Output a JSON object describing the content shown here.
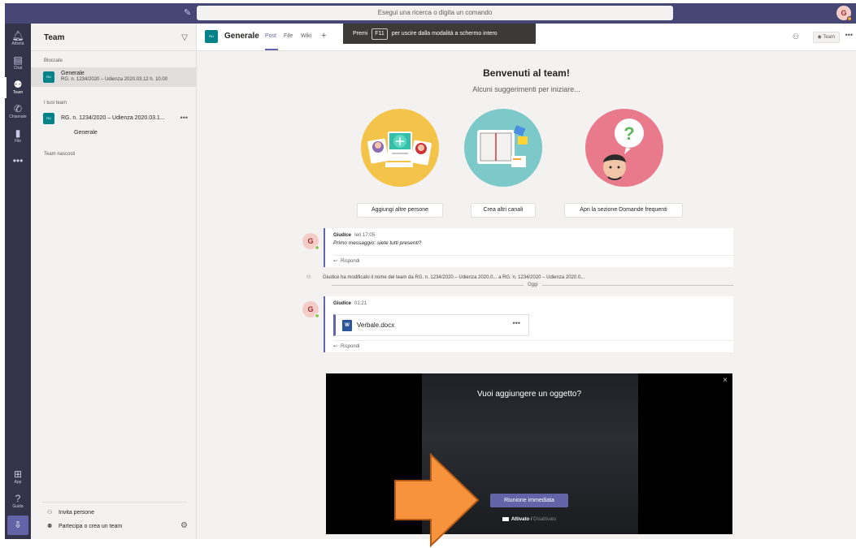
{
  "topbar": {
    "search_placeholder": "Esegui una ricerca o digita un comando",
    "avatar_initial": "G"
  },
  "rail": {
    "items": [
      {
        "label": "Attività",
        "icon": "bell-icon"
      },
      {
        "label": "Chat",
        "icon": "chat-icon"
      },
      {
        "label": "Team",
        "icon": "teams-icon"
      },
      {
        "label": "Chiamate",
        "icon": "phone-icon"
      },
      {
        "label": "File",
        "icon": "file-icon"
      }
    ],
    "more": "•••",
    "apps_label": "App",
    "help_label": "Guida"
  },
  "team_panel": {
    "title": "Team",
    "section_pinned": "Bloccate",
    "pinned": {
      "tile": "RU",
      "name": "Generale",
      "subtitle": "RG. n. 1234/2020 – Udienza 2020.03.12 h. 10.00"
    },
    "section_your_teams": "I tuoi team",
    "team": {
      "tile": "RU",
      "name": "RG. n. 1234/2020 – Udienza 2020.03.1...",
      "more": "•••",
      "channel": "Generale"
    },
    "section_hidden": "Team nascosti",
    "invite": "Invita persone",
    "join": "Partecipa o crea un team"
  },
  "header": {
    "tile": "RU",
    "title": "Generale",
    "tabs": [
      "Post",
      "File",
      "Wiki"
    ],
    "add": "+",
    "toast_before": "Premi",
    "toast_key": "F11",
    "toast_after": "per uscire dalla modalità a schermo intero",
    "team_button": "Team",
    "more": "•••"
  },
  "welcome": {
    "title": "Benvenuti al team!",
    "subtitle": "Alcuni suggerimenti per iniziare...",
    "buttons": [
      "Aggiungi altre persone",
      "Crea altri canali",
      "Apri la sezione Domande frequenti"
    ]
  },
  "messages": [
    {
      "avatar": "G",
      "author": "Giudice",
      "time": "Ieri 17:05",
      "text": "Primo messaggio: siete tutti presenti?",
      "reply": "Rispondi"
    },
    {
      "avatar": "G",
      "author": "Giudice",
      "time": "01:21",
      "file": "Verbale.docx",
      "file_more": "•••",
      "reply": "Rispondi"
    }
  ],
  "system_line": "Giudice ha modificato il nome del team da RG. n. 1234/2020 – Udienza 2020.0... a RG. n. 1234/2020 – Udienza 2020.0...",
  "today_label": "Oggi",
  "meeting": {
    "question": "Vuoi aggiungere un oggetto?",
    "button": "Riunione immediata",
    "video_on": "Attivato",
    "separator": "/",
    "video_off": "Disattivato",
    "close": "×"
  },
  "colors": {
    "accent": "#6264a7",
    "topbar": "#464775",
    "rail": "#33344a",
    "team_tile": "#038387",
    "arrow": "#f7933d"
  }
}
